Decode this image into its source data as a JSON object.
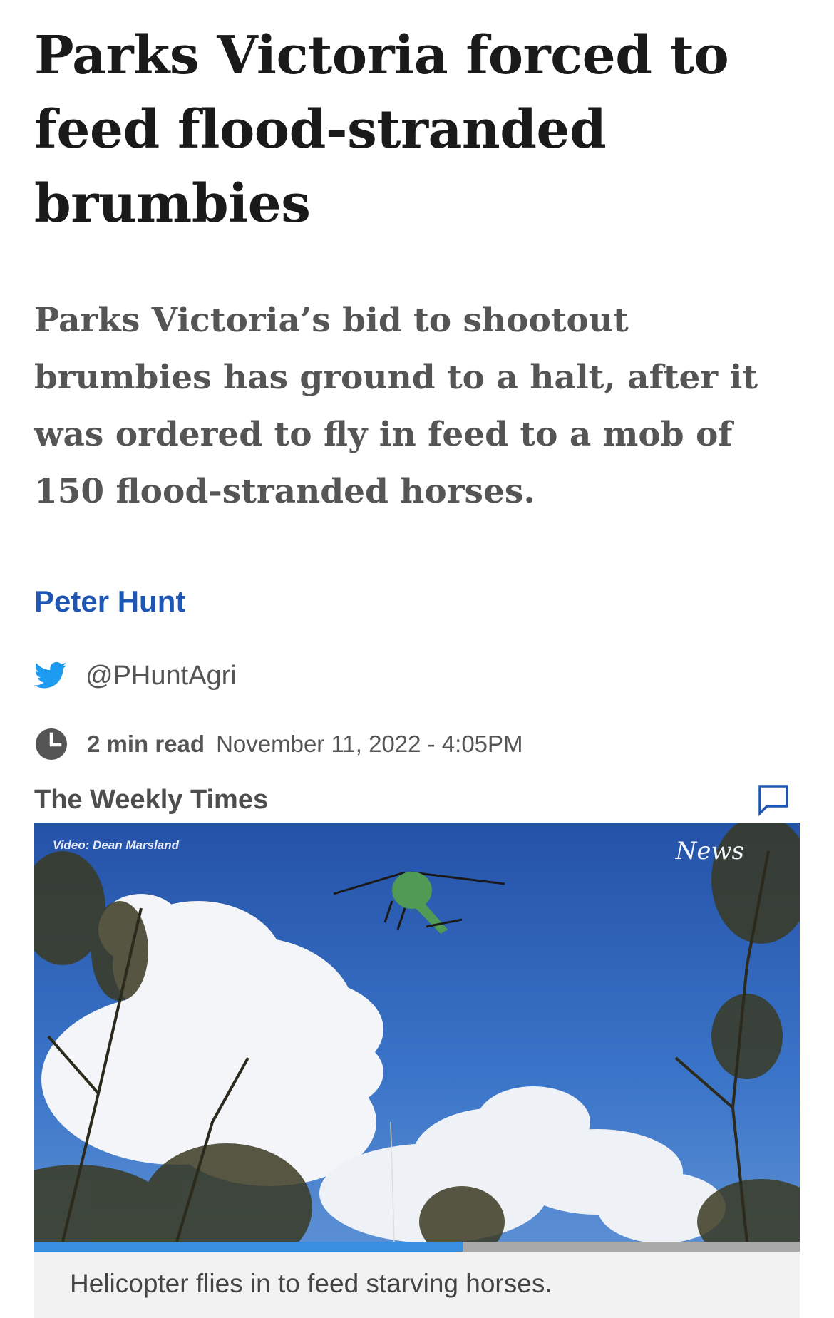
{
  "article": {
    "headline": "Parks Victoria forced to feed flood-stranded brumbies",
    "standfirst": "Parks Victoria’s bid to shootout brumbies has ground to a halt, after it was ordered to fly in feed to a mob of 150 flood-stranded horses.",
    "author": "Peter Hunt",
    "twitter_handle": "@PHuntAgri",
    "read_time": "2 min read",
    "date": "November 11, 2022 - 4:05PM",
    "source": "The Weekly Times"
  },
  "video": {
    "credit": "Video: Dean Marsland",
    "logo": "News",
    "progress": 0.56,
    "caption": "Helicopter flies in to feed starving horses."
  },
  "icons": {
    "twitter": "twitter-bird-icon",
    "clock": "clock-icon",
    "comment": "comment-bubble-icon"
  },
  "colors": {
    "link_blue": "#1f56b3",
    "twitter_blue": "#1d9bf0",
    "progress_blue": "#3a8ee0",
    "sky_blue": "#2f62b8"
  }
}
